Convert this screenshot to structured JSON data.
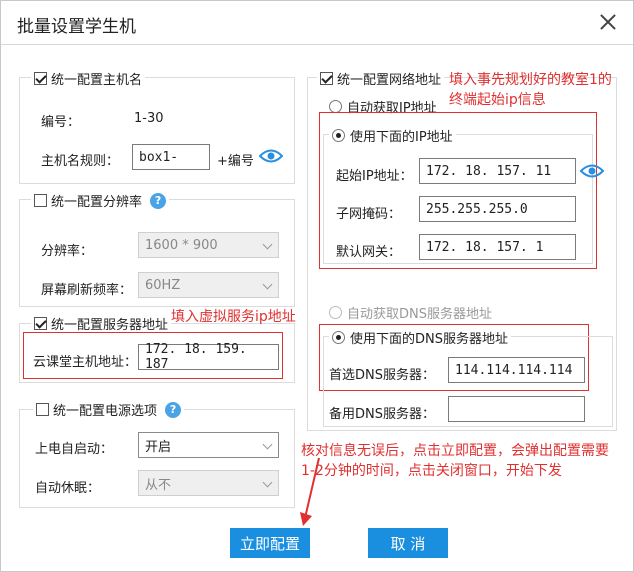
{
  "dialog": {
    "title": "批量设置学生机"
  },
  "hostname": {
    "legend": "统一配置主机名",
    "checked": true,
    "number_label": "编号：",
    "number_value": "1-30",
    "rule_label": "主机名规则：",
    "rule_value": "box1-",
    "suffix": "+编号"
  },
  "resolution": {
    "legend": "统一配置分辨率",
    "checked": false,
    "help": "?",
    "resolution_label": "分辨率：",
    "resolution_value": "1600 * 900",
    "refresh_label": "屏幕刷新频率：",
    "refresh_value": "60HZ"
  },
  "server": {
    "legend": "统一配置服务器地址",
    "checked": true,
    "host_label": "云课堂主机地址：",
    "host_value": "172. 18. 159. 187"
  },
  "power": {
    "legend": "统一配置电源选项",
    "checked": false,
    "help": "?",
    "autostart_label": "上电自启动：",
    "autostart_value": "开启",
    "sleep_label": "自动休眠：",
    "sleep_value": "从不"
  },
  "network": {
    "legend": "统一配置网络地址",
    "checked": true,
    "auto_ip": "自动获取IP地址",
    "manual_ip": "使用下面的IP地址",
    "start_ip_label": "起始IP地址：",
    "start_ip_value": "172. 18. 157. 11",
    "mask_label": "子网掩码：",
    "mask_value": "255.255.255.0",
    "gateway_label": "默认网关：",
    "gateway_value": "172. 18. 157. 1",
    "auto_dns": "自动获取DNS服务器地址",
    "manual_dns": "使用下面的DNS服务器地址",
    "dns1_label": "首选DNS服务器：",
    "dns1_value": "114.114.114.114",
    "dns2_label": "备用DNS服务器：",
    "dns2_value": ""
  },
  "annotations": {
    "network_note_1": "填入事先规划好的教室1的",
    "network_note_2": "终端起始ip信息",
    "server_note": "填入虚拟服务ip地址",
    "bottom_note_1": "核对信息无误后，点击立即配置，会弹出配置需要",
    "bottom_note_2": "1-2分钟的时间，点击关闭窗口，开始下发"
  },
  "buttons": {
    "apply": "立即配置",
    "cancel": "取 消"
  },
  "colors": {
    "accent": "#1a8fe0",
    "annotation": "#e03030"
  }
}
